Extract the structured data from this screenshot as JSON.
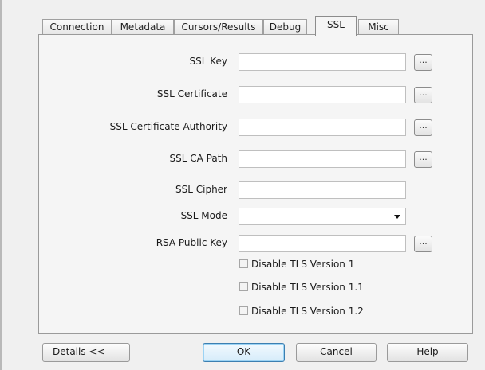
{
  "tabs": [
    {
      "label": "Connection",
      "active": false
    },
    {
      "label": "Metadata",
      "active": false
    },
    {
      "label": "Cursors/Results",
      "active": false
    },
    {
      "label": "Debug",
      "active": false
    },
    {
      "label": "SSL",
      "active": true
    },
    {
      "label": "Misc",
      "active": false
    }
  ],
  "ssl": {
    "fields": [
      {
        "label": "SSL Key",
        "value": "",
        "browse": "..."
      },
      {
        "label": "SSL Certificate",
        "value": "",
        "browse": "..."
      },
      {
        "label": "SSL Certificate Authority",
        "value": "",
        "browse": "..."
      },
      {
        "label": "SSL CA Path",
        "value": "",
        "browse": "..."
      },
      {
        "label": "SSL Cipher",
        "value": ""
      },
      {
        "label": "SSL Mode",
        "value": ""
      },
      {
        "label": "RSA Public Key",
        "value": "",
        "browse": "..."
      }
    ],
    "checkboxes": [
      {
        "label": "Disable TLS Version 1",
        "checked": false
      },
      {
        "label": "Disable TLS Version 1.1",
        "checked": false
      },
      {
        "label": "Disable TLS Version 1.2",
        "checked": false
      }
    ]
  },
  "buttons": {
    "details": "Details <<",
    "ok": "OK",
    "cancel": "Cancel",
    "help": "Help"
  },
  "colors": {
    "dialog_bg": "#f0f0f0",
    "default_button_border": "#3c7fb1"
  }
}
